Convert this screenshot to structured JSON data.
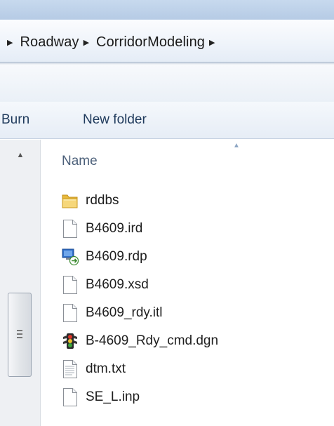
{
  "breadcrumb": {
    "items": [
      "Roadway",
      "CorridorModeling"
    ]
  },
  "toolbar": {
    "burn_label": "Burn",
    "new_folder_label": "New folder"
  },
  "file_list": {
    "column_header": "Name",
    "items": [
      {
        "name": "rddbs",
        "icon": "folder-icon"
      },
      {
        "name": "B4609.ird",
        "icon": "file-icon"
      },
      {
        "name": "B4609.rdp",
        "icon": "remote-desktop-file-icon"
      },
      {
        "name": "B4609.xsd",
        "icon": "file-icon"
      },
      {
        "name": "B4609_rdy.itl",
        "icon": "file-icon"
      },
      {
        "name": "B-4609_Rdy_cmd.dgn",
        "icon": "microstation-dgn-icon"
      },
      {
        "name": "dtm.txt",
        "icon": "text-file-icon"
      },
      {
        "name": "SE_L.inp",
        "icon": "file-icon"
      }
    ]
  }
}
